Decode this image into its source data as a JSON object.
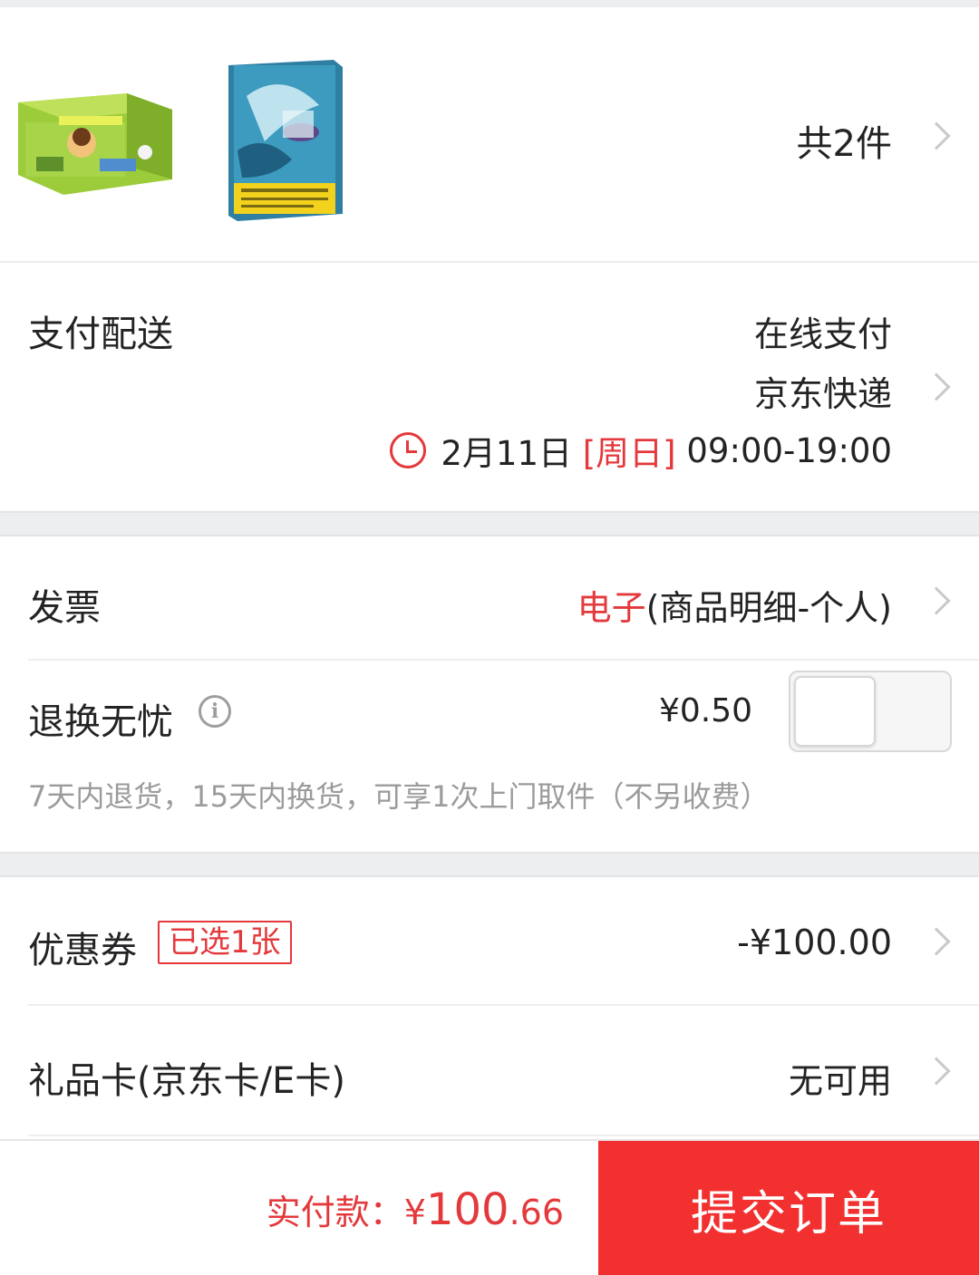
{
  "products": {
    "count_label": "共2件"
  },
  "payment": {
    "label": "支付配送",
    "method": "在线支付",
    "courier": "京东快递",
    "date": "2月11日",
    "weekday": "[周日]",
    "time_range": "09:00-19:00"
  },
  "invoice": {
    "label": "发票",
    "type": "电子",
    "detail": "(商品明细-个人)"
  },
  "return_service": {
    "label": "退换无忧",
    "price": "¥0.50",
    "enabled": false,
    "note": "7天内退货，15天内换货，可享1次上门取件（不另收费）"
  },
  "coupon": {
    "label": "优惠券",
    "badge": "已选1张",
    "amount": "-¥100.00"
  },
  "gift_card": {
    "label": "礼品卡(京东卡/E卡)",
    "status": "无可用"
  },
  "footer": {
    "total_label": "实付款：",
    "currency": "¥",
    "total_int": "100",
    "total_dec": ".66",
    "submit_label": "提交订单"
  },
  "colors": {
    "accent": "#e4393c",
    "submit_bg": "#f2302f"
  }
}
